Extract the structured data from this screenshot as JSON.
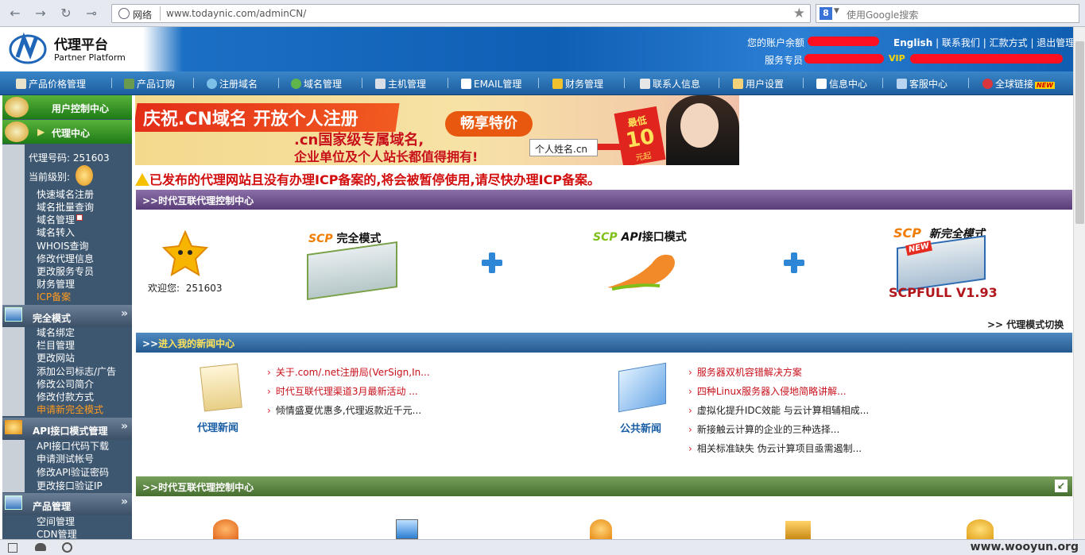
{
  "browser": {
    "net_label": "网络",
    "url": "www.todaynic.com/adminCN/",
    "search_placeholder": "使用Google搜索",
    "search_engine": "8"
  },
  "header": {
    "logo_cn": "代理平台",
    "logo_en": "Partner Platform",
    "balance_label": "您的账户余额",
    "service_label": "服务专员",
    "vip_label": "VIP",
    "links": [
      "English",
      "联系我们",
      "汇款方式",
      "退出管理"
    ]
  },
  "nav": {
    "items": [
      "产品价格管理",
      "产品订购",
      "注册域名",
      "域名管理",
      "主机管理",
      "EMAIL管理",
      "财务管理",
      "联系人信息",
      "用户设置",
      "信息中心",
      "客服中心",
      "全球链接"
    ],
    "new_badge": "NEW"
  },
  "sidebar": {
    "user_center": "用户控制中心",
    "agent_center": "代理中心",
    "agent_id_label": "代理号码:",
    "agent_id": "251603",
    "level_label": "当前级别:",
    "agent_items": [
      "快速域名注册",
      "域名批量查询",
      "域名管理",
      "域名转入",
      "WHOIS查询",
      "修改代理信息",
      "更改服务专员",
      "财务管理",
      "ICP备案"
    ],
    "full_mode": "完全模式",
    "full_mode_items": [
      "域名绑定",
      "栏目管理",
      "更改网站",
      "添加公司标志/广告",
      "修改公司简介",
      "修改付款方式",
      "申请新完全模式"
    ],
    "api_mode": "API接口模式管理",
    "api_items": [
      "API接口代码下载",
      "申请测试帐号",
      "修改API验证密码",
      "更改接口验证IP"
    ],
    "product": "产品管理",
    "product_items": [
      "空间管理",
      "CDN管理"
    ]
  },
  "banner": {
    "line1": "庆祝.CN域名 开放个人注册",
    "tag": "畅享特价",
    "line2": ".cn国家级专属域名,",
    "line3": "企业单位及个人站长都值得拥有!",
    "input_text": "个人姓名.cn",
    "price_top": "最低",
    "price": "10",
    "price_unit": "元起"
  },
  "warning": "已发布的代理网站且没有办理ICP备案的,将会被暂停使用,请尽快办理ICP备案。",
  "control": {
    "title": ">>时代互联代理控制中心",
    "welcome_label": "欢迎您:",
    "welcome_id": "251603",
    "mode1_scp": "SCP",
    "mode1": "完全模式",
    "mode2_scp": "SCP",
    "mode2_api": "API",
    "mode2": "接口模式",
    "mode3_scp": "SCP",
    "mode3": "新完全模式",
    "mode3_new": "NEW",
    "mode3_name": "SCPFULL V1.93",
    "switch": ">> 代理模式切换"
  },
  "news": {
    "title_prefix": ">>",
    "title": "进入我的新闻中心",
    "agent_label": "代理新闻",
    "public_label": "公共新闻",
    "agent_news": [
      {
        "text": "关于.com/.net注册局(VerSign,In...",
        "color": "#c8101b"
      },
      {
        "text": "时代互联代理渠道3月最新活动 ...",
        "color": "#c8101b"
      },
      {
        "text": "倾情盛夏优惠多,代理返款近千元...",
        "color": "#222222"
      }
    ],
    "public_news": [
      {
        "text": "服务器双机容错解决方案",
        "color": "#c8101b"
      },
      {
        "text": "四种Linux服务器入侵地简略讲解...",
        "color": "#c8101b"
      },
      {
        "text": "虚拟化提升IDC效能 与云计算相辅相成...",
        "color": "#222222"
      },
      {
        "text": "新接触云计算的企业的三种选择...",
        "color": "#222222"
      },
      {
        "text": "相关标准缺失 伪云计算项目亟需遏制...",
        "color": "#222222"
      }
    ]
  },
  "bottom_bar": {
    "title": ">>时代互联代理控制中心"
  },
  "status": {
    "watermark": "www.wooyun.org"
  },
  "colors": {
    "nav_bg": "#1d5e9f",
    "sidebar_bg": "#3e5770",
    "sidebar_head": "#3a9a2a",
    "bar_purple": "#6b4a8a",
    "bar_blue": "#2a6496",
    "bar_green": "#4f7d3a",
    "warning": "#d20d0d",
    "highlight": "#ff9b1f"
  }
}
